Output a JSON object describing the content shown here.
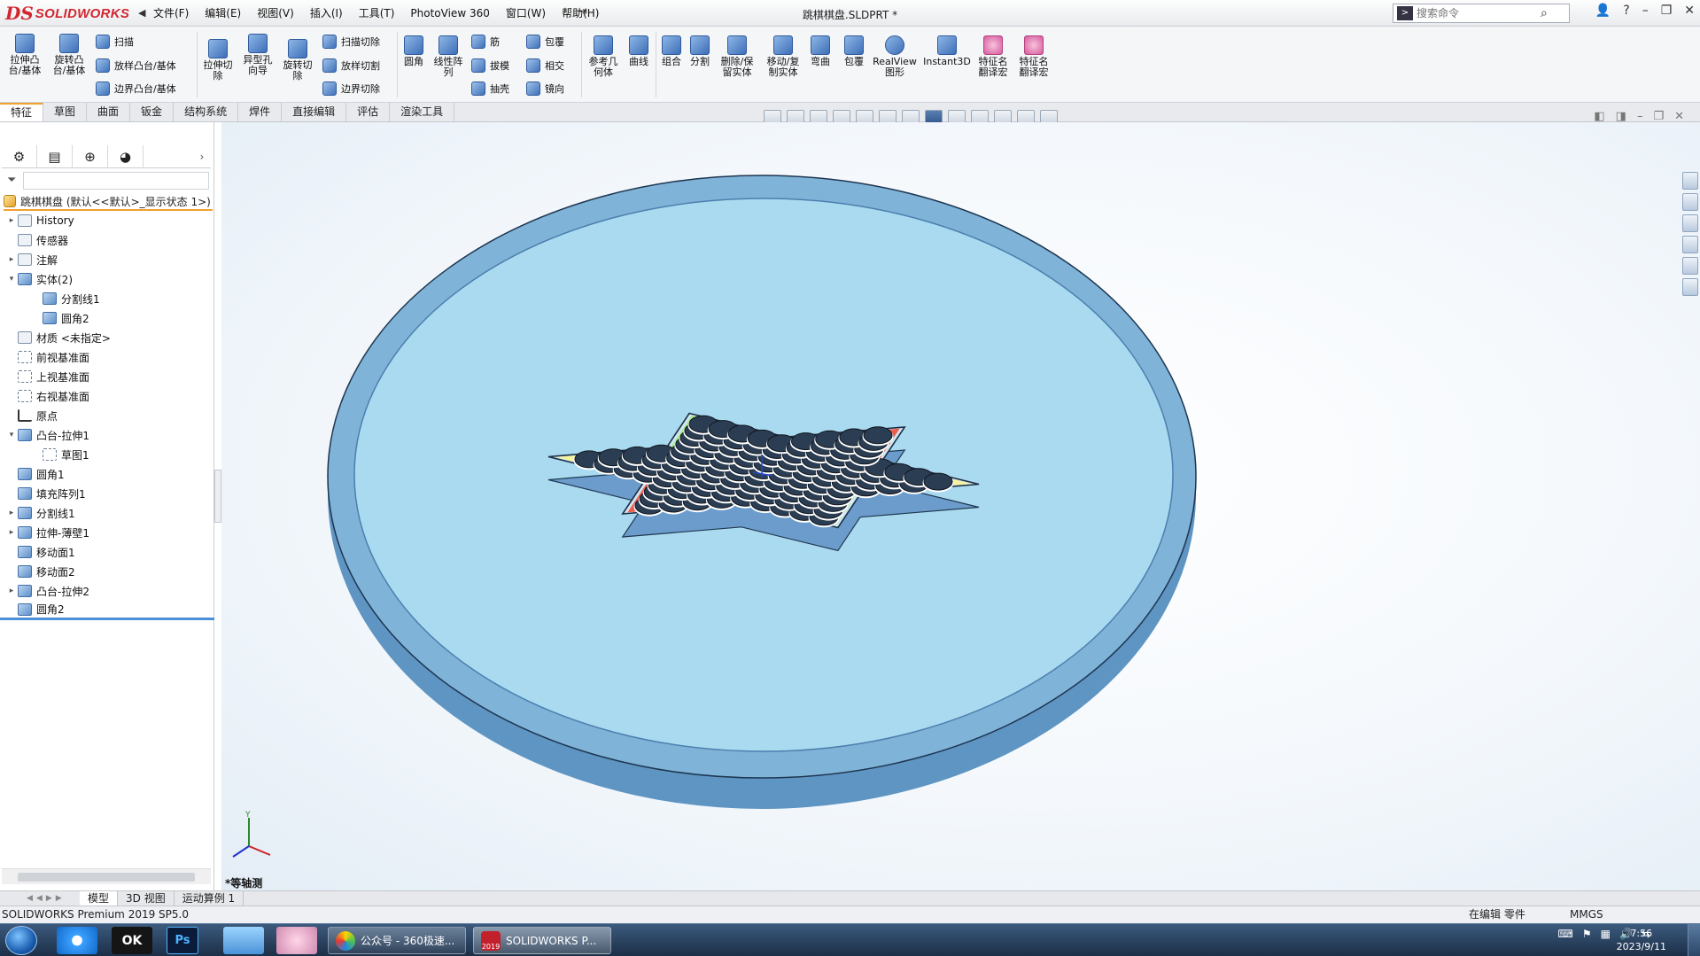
{
  "app": {
    "brand_mark": "DS",
    "brand_name": "SOLIDWORKS",
    "title": "跳棋棋盘.SLDPRT *"
  },
  "menu": [
    "文件(F)",
    "编辑(E)",
    "视图(V)",
    "插入(I)",
    "工具(T)",
    "PhotoView 360",
    "窗口(W)",
    "帮助(H)"
  ],
  "search": {
    "placeholder": "搜索命令"
  },
  "ribbon": {
    "extrude_boss": "拉伸凸台/基体",
    "revolve_boss": "旋转凸台/基体",
    "sweep": "扫描",
    "loft": "放样凸台/基体",
    "boundary": "边界凸台/基体",
    "extrude_cut": "拉伸切除",
    "hole_wizard": "异型孔向导",
    "revolve_cut": "旋转切除",
    "sweep_cut": "扫描切除",
    "loft_cut": "放样切割",
    "boundary_cut": "边界切除",
    "fillet": "圆角",
    "linear_pattern": "线性阵列",
    "rib": "筋",
    "draft": "拔模",
    "shell": "抽壳",
    "wrap": "包覆",
    "intersect": "相交",
    "mirror": "镜向",
    "ref_geometry": "参考几何体",
    "curves": "曲线",
    "combine": "组合",
    "split": "分割",
    "delete_keep": "删除/保留实体",
    "move_copy": "移动/复制实体",
    "flex": "弯曲",
    "wrap2": "包覆",
    "realview": "RealView图形",
    "instant3d": "Instant3D",
    "translate1": "特征名翻译宏",
    "translate2": "特征名翻译宏"
  },
  "tabs": [
    "特征",
    "草图",
    "曲面",
    "钣金",
    "结构系统",
    "焊件",
    "直接编辑",
    "评估",
    "渲染工具"
  ],
  "feature_tree": {
    "root": "跳棋棋盘 (默认<<默认>_显示状态 1>)",
    "items": [
      {
        "label": "History",
        "exp": "▸",
        "indent": 1,
        "icon": "doc"
      },
      {
        "label": "传感器",
        "exp": "",
        "indent": 1,
        "icon": "doc"
      },
      {
        "label": "注解",
        "exp": "▸",
        "indent": 1,
        "icon": "doc"
      },
      {
        "label": "实体(2)",
        "exp": "▾",
        "indent": 1,
        "icon": "solid"
      },
      {
        "label": "分割线1",
        "exp": "",
        "indent": 2,
        "icon": "solid"
      },
      {
        "label": "圆角2",
        "exp": "",
        "indent": 2,
        "icon": "solid"
      },
      {
        "label": "材质 <未指定>",
        "exp": "",
        "indent": 1,
        "icon": "doc"
      },
      {
        "label": "前视基准面",
        "exp": "",
        "indent": 1,
        "icon": "plane"
      },
      {
        "label": "上视基准面",
        "exp": "",
        "indent": 1,
        "icon": "plane"
      },
      {
        "label": "右视基准面",
        "exp": "",
        "indent": 1,
        "icon": "plane"
      },
      {
        "label": "原点",
        "exp": "",
        "indent": 1,
        "icon": "origin"
      },
      {
        "label": "凸台-拉伸1",
        "exp": "▾",
        "indent": 1,
        "icon": "solid"
      },
      {
        "label": "草图1",
        "exp": "",
        "indent": 2,
        "icon": "plane"
      },
      {
        "label": "圆角1",
        "exp": "",
        "indent": 1,
        "icon": "solid"
      },
      {
        "label": "填充阵列1",
        "exp": "",
        "indent": 1,
        "icon": "solid"
      },
      {
        "label": "分割线1",
        "exp": "▸",
        "indent": 1,
        "icon": "solid"
      },
      {
        "label": "拉伸-薄壁1",
        "exp": "▸",
        "indent": 1,
        "icon": "solid"
      },
      {
        "label": "移动面1",
        "exp": "",
        "indent": 1,
        "icon": "solid"
      },
      {
        "label": "移动面2",
        "exp": "",
        "indent": 1,
        "icon": "solid"
      },
      {
        "label": "凸台-拉伸2",
        "exp": "▸",
        "indent": 1,
        "icon": "solid"
      },
      {
        "label": "圆角2",
        "exp": "",
        "indent": 1,
        "icon": "solid"
      }
    ]
  },
  "viewport": {
    "view_label": "*等轴测",
    "colors": {
      "tray": "#a9daf0",
      "tray_rim": "#7fb4d8",
      "tray_dark": "#5f95c2",
      "board_rim": "#cfe6f3",
      "green": "#a6ec88",
      "red": "#f25a4a",
      "yellow": "#f6f3a0",
      "hole": "#2b3d52"
    }
  },
  "bottom_tabs": [
    "模型",
    "3D 视图",
    "运动算例 1"
  ],
  "status": {
    "left": "SOLIDWORKS Premium 2019 SP5.0",
    "mode": "在编辑 零件",
    "units": "MMGS"
  },
  "taskbar": {
    "ps_label": "Ps",
    "window1": "公众号 - 360极速...",
    "window2": "SOLIDWORKS P...",
    "sw_year": "2019",
    "time": "7:56",
    "date": "2023/9/11"
  }
}
